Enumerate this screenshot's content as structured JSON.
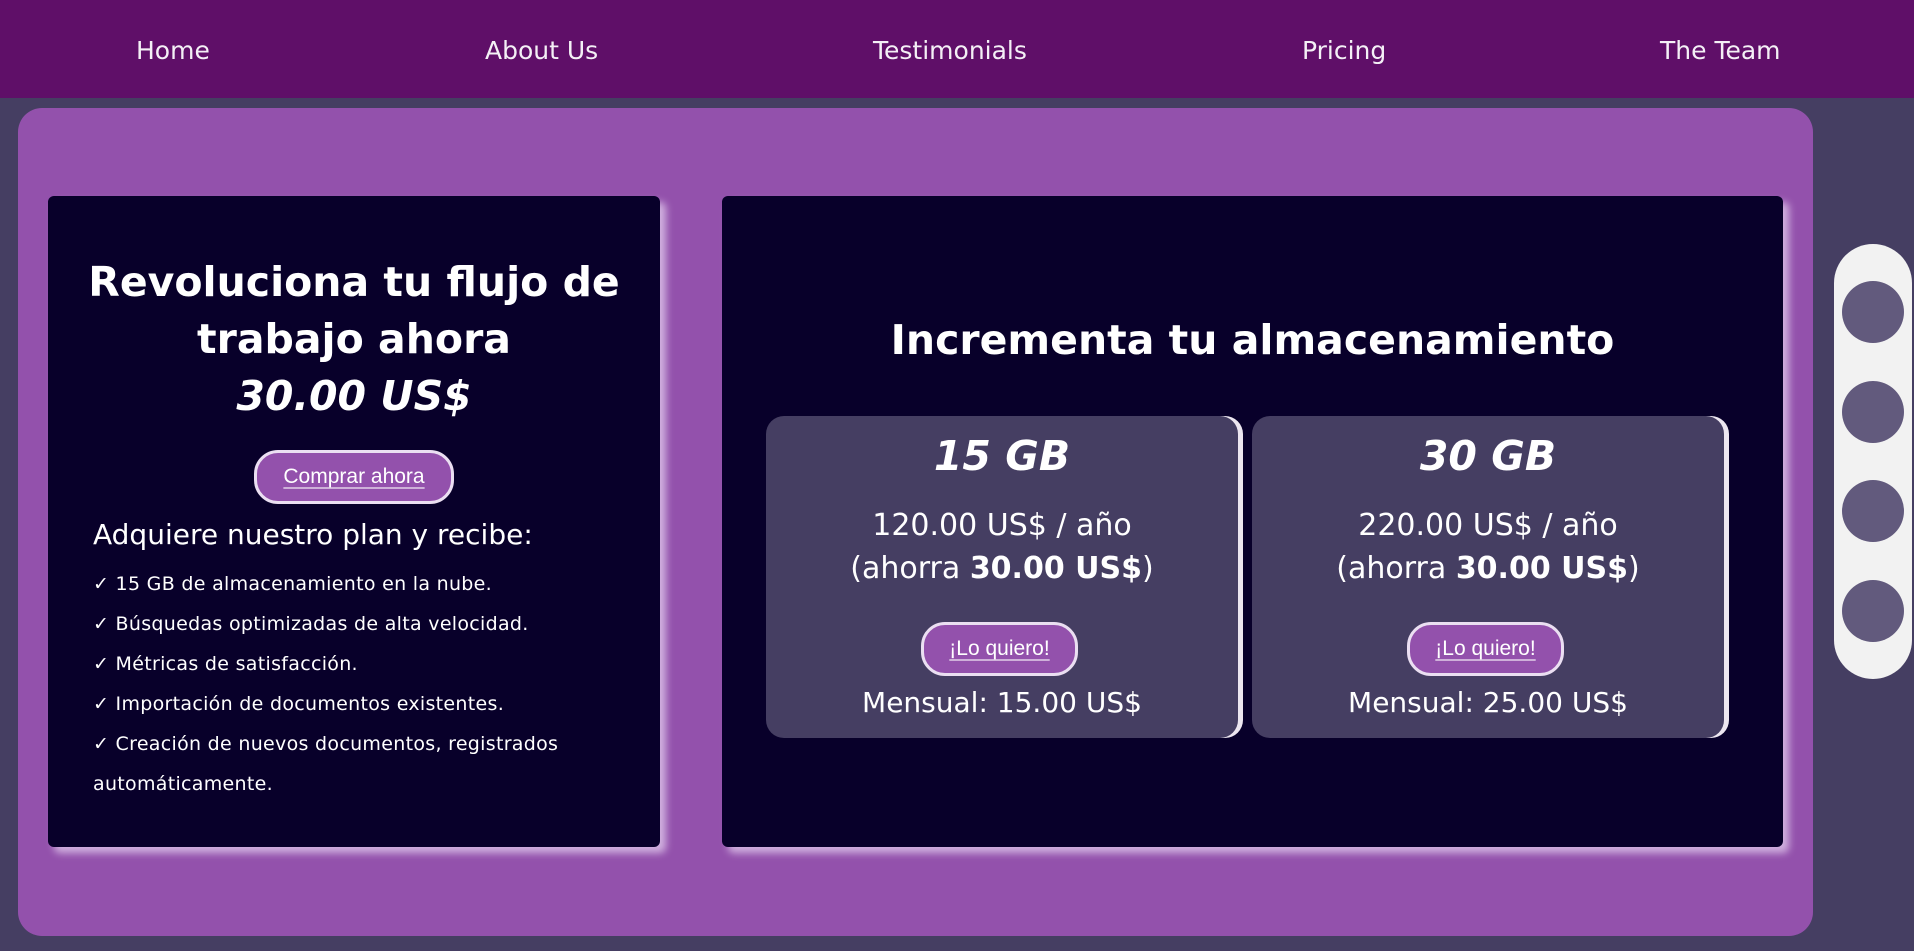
{
  "nav": {
    "items": [
      {
        "label": "Home"
      },
      {
        "label": "About Us"
      },
      {
        "label": "Testimonials"
      },
      {
        "label": "Pricing"
      },
      {
        "label": "The Team"
      }
    ]
  },
  "hero": {
    "title_line1": "Revoluciona tu flujo de",
    "title_line2": "trabajo ahora",
    "price": "30.00 US$",
    "buy_button": "Comprar ahora",
    "plan_intro": "Adquiere nuestro plan y recibe:",
    "features": [
      "✓ 15 GB de almacenamiento en la nube.",
      "✓ Búsquedas optimizadas de alta velocidad.",
      "✓ Métricas de satisfacción.",
      "✓ Importación de documentos existentes.",
      "✓ Creación de nuevos documentos, registrados automáticamente."
    ]
  },
  "storage": {
    "title": "Incrementa tu almacenamiento",
    "offers": [
      {
        "size": "15 GB",
        "yearly": "120.00 US$ / año",
        "save_prefix": "(ahorra ",
        "save_amount": "30.00 US$",
        "save_suffix": ")",
        "button": "¡Lo quiero!",
        "monthly": "Mensual: 15.00 US$"
      },
      {
        "size": "30 GB",
        "yearly": "220.00 US$ / año",
        "save_prefix": "(ahorra ",
        "save_amount": "30.00 US$",
        "save_suffix": ")",
        "button": "¡Lo quiero!",
        "monthly": "Mensual: 25.00 US$"
      }
    ]
  },
  "colors": {
    "nav_bg": "#5f0f68",
    "page_bg": "#453e62",
    "panel_bg": "#9351ac",
    "card_bg": "#08002a",
    "offer_bg": "#453e62",
    "button_bg": "#9351ac",
    "dot": "#625a7d"
  },
  "carousel": {
    "dot_count": 4
  }
}
